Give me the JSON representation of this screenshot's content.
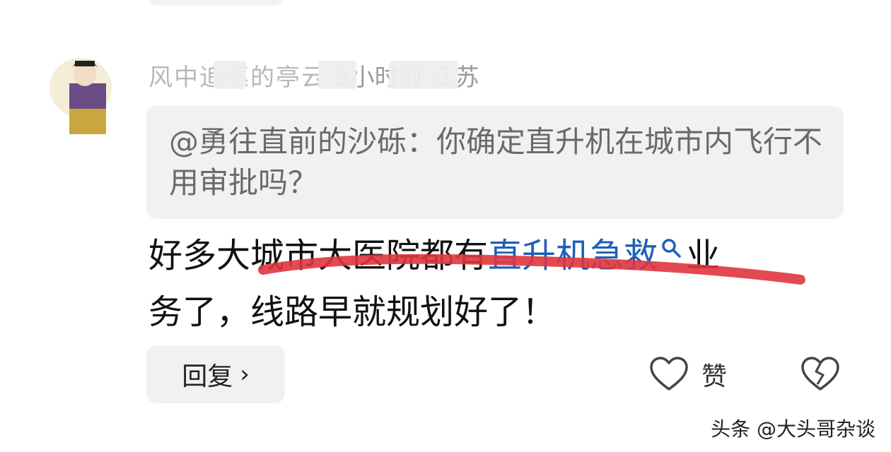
{
  "author": {
    "name_visible": "风中追巫的亭云",
    "time": "5小时前",
    "location": "江苏"
  },
  "quote": {
    "text": "@勇往直前的沙砾：你确定直升机在城市内飞行不用审批吗？"
  },
  "comment": {
    "line1_before_link": "好多大城市大医院都有",
    "link_text": "直升机急救",
    "line1_after_link": "业",
    "line2": "务了，线路早就规划好了！"
  },
  "actions": {
    "reply_label": "回复",
    "reply_chevron": "›",
    "like_label": "赞"
  },
  "watermark": "头条 @大头哥杂谈",
  "colors": {
    "link": "#1f5fb8",
    "underline_stroke": "#e0353e",
    "quote_bg": "#f1f1f3",
    "meta_text": "#9b9b9b"
  },
  "icons": {
    "search": "search-icon",
    "like": "heart-icon",
    "dislike": "broken-heart-icon",
    "reply": "chevron-right-icon"
  }
}
